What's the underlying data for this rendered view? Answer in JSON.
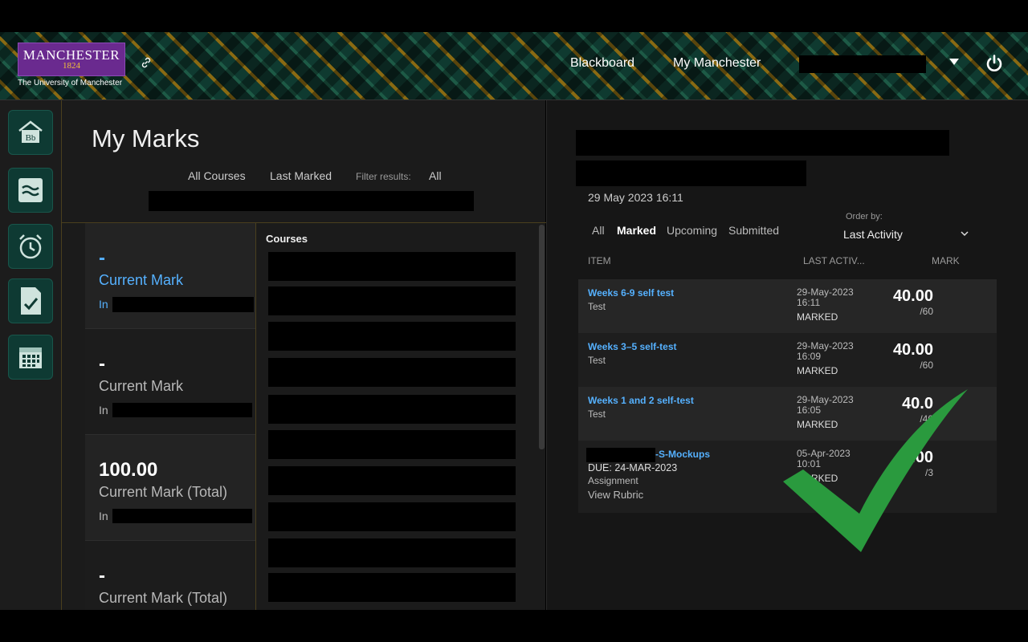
{
  "header": {
    "logo_word": "MANCHESTER",
    "logo_year": "1824",
    "logo_subtitle": "The University of Manchester",
    "nav": [
      "Blackboard",
      "My Manchester"
    ],
    "icons": [
      "link-icon",
      "caret-down-icon",
      "power-icon"
    ]
  },
  "rail": {
    "items": [
      "blackboard-home-icon",
      "activity-stream-icon",
      "alarm-clock-icon",
      "marks-icon",
      "calendar-icon"
    ]
  },
  "main": {
    "title": "My Marks",
    "filters": {
      "all_courses": "All Courses",
      "last_marked": "Last Marked",
      "filter_label": "Filter results:",
      "filter_value": "All"
    },
    "mark_cards": [
      {
        "value": "-",
        "label": "Current Mark",
        "in": "In",
        "active": true
      },
      {
        "value": "-",
        "label": "Current Mark",
        "in": "In",
        "active": false
      },
      {
        "value": "100.00",
        "label": "Current Mark (Total)",
        "in": "In",
        "active": false
      },
      {
        "value": "-",
        "label": "Current Mark (Total)",
        "in": "",
        "active": false
      }
    ],
    "courses_heading": "Courses"
  },
  "detail": {
    "date": "29 May 2023 16:11",
    "tabs": [
      "All",
      "Marked",
      "Upcoming",
      "Submitted"
    ],
    "active_tab": "Marked",
    "order_by_label": "Order by:",
    "order_by_value": "Last Activity",
    "columns": [
      "ITEM",
      "LAST ACTIV...",
      "MARK"
    ],
    "rows": [
      {
        "title": "Weeks 6-9 self test",
        "type": "Test",
        "date": "29-May-2023",
        "time": "16:11",
        "status": "MARKED",
        "score": "40.00",
        "total": "/60"
      },
      {
        "title": "Weeks 3–5 self-test",
        "type": "Test",
        "date": "29-May-2023",
        "time": "16:09",
        "status": "MARKED",
        "score": "40.00",
        "total": "/60"
      },
      {
        "title": "Weeks 1 and 2 self-test",
        "type": "Test",
        "date": "29-May-2023",
        "time": "16:05",
        "status": "MARKED",
        "score": "40.0",
        "total": "/40"
      },
      {
        "title": "-S-Mockups",
        "due": "DUE: 24-MAR-2023",
        "type": "Assignment",
        "rubric": "View Rubric",
        "date": "05-Apr-2023",
        "time": "10:01",
        "status": "MARKED",
        "score": "3.00",
        "total": "/3"
      }
    ]
  },
  "colors": {
    "accent_link": "#55b1ff",
    "logo_purple": "#6a2a8f",
    "rail_teal": "#0e3a33",
    "check_green": "#2a9a3e"
  }
}
